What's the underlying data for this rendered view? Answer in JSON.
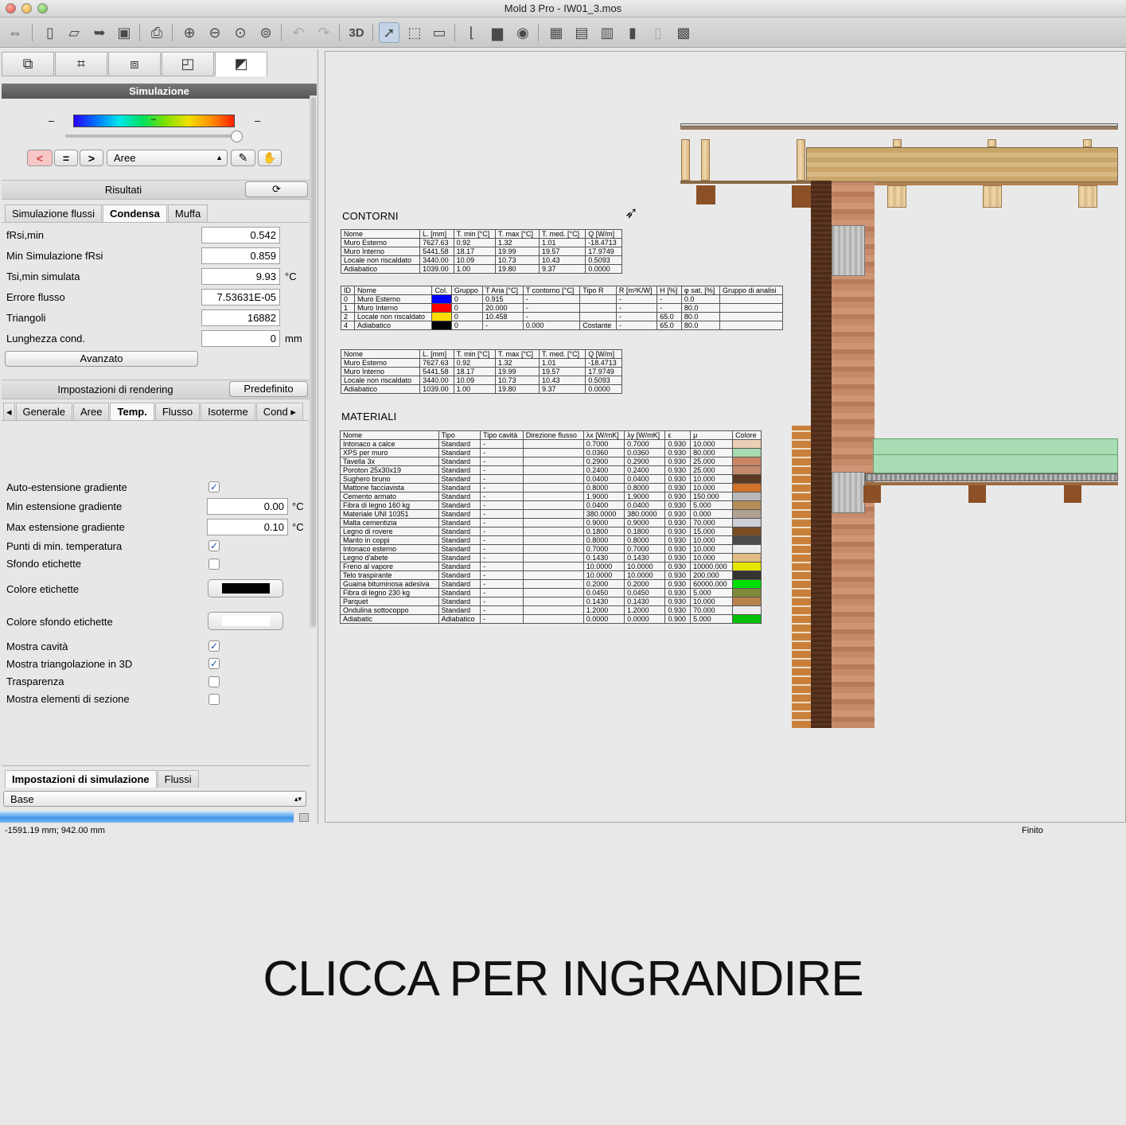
{
  "window": {
    "title": "Mold 3 Pro - IW01_3.mos"
  },
  "toolbar": {
    "label_3d": "3D"
  },
  "sim": {
    "title": "Simulazione",
    "grad_min": "–",
    "grad_mid": "–",
    "grad_max": "–",
    "area_select": "Aree",
    "btn_lt": "<",
    "btn_eq": "=",
    "btn_gt": ">"
  },
  "results": {
    "title": "Risultati",
    "tabs": [
      "Simulazione flussi",
      "Condensa",
      "Muffa"
    ],
    "fields": [
      {
        "label": "fRsi,min",
        "value": "0.542",
        "unit": ""
      },
      {
        "label": "Min Simulazione fRsi",
        "value": "0.859",
        "unit": ""
      },
      {
        "label": "Tsi,min simulata",
        "value": "9.93",
        "unit": "°C"
      },
      {
        "label": "Errore flusso",
        "value": "7.53631E-05",
        "unit": ""
      },
      {
        "label": "Triangoli",
        "value": "16882",
        "unit": ""
      },
      {
        "label": "Lunghezza cond.",
        "value": "0",
        "unit": "mm"
      }
    ],
    "advanced": "Avanzato"
  },
  "render": {
    "title": "Impostazioni di rendering",
    "default_btn": "Predefinito",
    "tabs": [
      "Generale",
      "Aree",
      "Temp.",
      "Flusso",
      "Isoterme",
      "Cond"
    ],
    "auto_ext": "Auto-estensione gradiente",
    "min_ext": "Min estensione gradiente",
    "min_val": "0.00",
    "max_ext": "Max estensione gradiente",
    "max_val": "0.10",
    "unit": "°C",
    "min_pts": "Punti di min. temperatura",
    "label_bg": "Sfondo etichette",
    "label_color": "Colore etichette",
    "label_bg_color": "Colore sfondo etichette",
    "show_cavity": "Mostra cavità",
    "show_tri": "Mostra triangolazione in 3D",
    "transparency": "Trasparenza",
    "show_section": "Mostra elementi di sezione"
  },
  "simsettings": {
    "tabs": [
      "Impostazioni di simulazione",
      "Flussi"
    ],
    "preset": "Base"
  },
  "status": {
    "coords": "-1591.19 mm; 942.00 mm",
    "state": "Finito"
  },
  "canvas": {
    "contorni_title": "CONTORNI",
    "materiali_title": "MATERIALI",
    "flow_header": [
      "Nome",
      "L. [mm]",
      "T. min [°C]",
      "T. max [°C]",
      "T. med. [°C]",
      "Q [W/m]"
    ],
    "flow_rows": [
      [
        "Muro Esterno",
        "7627.63",
        "0.92",
        "1.32",
        "1.01",
        "-18.4713"
      ],
      [
        "Muro Interno",
        "5441.58",
        "18.17",
        "19.99",
        "19.57",
        "17.9749"
      ],
      [
        "Locale non riscaldato",
        "3440.00",
        "10.09",
        "10.73",
        "10.43",
        "0.5093"
      ],
      [
        "Adiabatico",
        "1039.00",
        "1.00",
        "19.80",
        "9.37",
        "0.0000"
      ]
    ],
    "bc_header": [
      "ID",
      "Nome",
      "Col.",
      "Gruppo",
      "T Aria [°C]",
      "T contorno [°C]",
      "Tipo R",
      "R [m²K/W]",
      "H [%]",
      "φ sat. [%]",
      "Gruppo di analisi"
    ],
    "bc_rows": [
      [
        "0",
        "Muro Esterno",
        "#0000ff",
        "0",
        "0.915",
        "-",
        "",
        "-",
        "-",
        "0.0",
        ""
      ],
      [
        "1",
        "Muro Interno",
        "#ff0000",
        "0",
        "20.000",
        "-",
        "",
        "-",
        "-",
        "80.0",
        ""
      ],
      [
        "2",
        "Locale non riscaldato",
        "#ffdd00",
        "0",
        "10.458",
        "-",
        "",
        "-",
        "65.0",
        "80.0",
        ""
      ],
      [
        "4",
        "Adiabatico",
        "#000000",
        "0",
        "-",
        "0.000",
        "Costante",
        "-",
        "65.0",
        "80.0",
        ""
      ]
    ],
    "mat_header": [
      "Nome",
      "Tipo",
      "Tipo cavità",
      "Direzione flusso",
      "λx [W/mK]",
      "λy [W/mK]",
      "ε",
      "μ",
      "Colore"
    ],
    "mat_rows": [
      [
        "Intonaco a calce",
        "Standard",
        "-",
        "",
        "0.7000",
        "0.7000",
        "0.930",
        "10.000",
        "#e8cfb5"
      ],
      [
        "XPS per muro",
        "Standard",
        "-",
        "",
        "0.0360",
        "0.0360",
        "0.930",
        "80.000",
        "#a7dcb0"
      ],
      [
        "Tavella 3x",
        "Standard",
        "-",
        "",
        "0.2900",
        "0.2900",
        "0.930",
        "25.000",
        "#c98464"
      ],
      [
        "Poroton 25x30x19",
        "Standard",
        "-",
        "",
        "0.2400",
        "0.2400",
        "0.930",
        "25.000",
        "#c48a6e"
      ],
      [
        "Sughero bruno",
        "Standard",
        "-",
        "",
        "0.0400",
        "0.0400",
        "0.930",
        "10.000",
        "#5a3a22"
      ],
      [
        "Mattone facciavista",
        "Standard",
        "-",
        "",
        "0.8000",
        "0.8000",
        "0.930",
        "10.000",
        "#d1742a"
      ],
      [
        "Cemento armato",
        "Standard",
        "-",
        "",
        "1.9000",
        "1.9000",
        "0.930",
        "150.000",
        "#b8b8b8"
      ],
      [
        "Fibra di legno 160 kg",
        "Standard",
        "-",
        "",
        "0.0400",
        "0.0400",
        "0.930",
        "5.000",
        "#b58e5a"
      ],
      [
        "Materiale UNI 10351",
        "Standard",
        "-",
        "",
        "380.0000",
        "380.0000",
        "0.930",
        "0.000",
        "#b0a090"
      ],
      [
        "Malta cementizia",
        "Standard",
        "-",
        "",
        "0.9000",
        "0.9000",
        "0.930",
        "70.000",
        "#cfcfd8"
      ],
      [
        "Legno di rovere",
        "Standard",
        "-",
        "",
        "0.1800",
        "0.1800",
        "0.930",
        "15.000",
        "#7a4e22"
      ],
      [
        "Manto in coppi",
        "Standard",
        "-",
        "",
        "0.8000",
        "0.8000",
        "0.930",
        "10.000",
        "#4a4a4a"
      ],
      [
        "Intonaco esterno",
        "Standard",
        "-",
        "",
        "0.7000",
        "0.7000",
        "0.930",
        "10.000",
        "#ececec"
      ],
      [
        "Legno d'abete",
        "Standard",
        "-",
        "",
        "0.1430",
        "0.1430",
        "0.930",
        "10.000",
        "#e0bd86"
      ],
      [
        "Freno al vapore",
        "Standard",
        "-",
        "",
        "10.0000",
        "10.0000",
        "0.930",
        "10000.000",
        "#e6e600"
      ],
      [
        "Telo traspirante",
        "Standard",
        "-",
        "",
        "10.0000",
        "10.0000",
        "0.930",
        "200.000",
        "#333333"
      ],
      [
        "Guaina bituminosa adesiva",
        "Standard",
        "-",
        "",
        "0.2000",
        "0.2000",
        "0.930",
        "60000.000",
        "#00e000"
      ],
      [
        "Fibra di legno 230 kg",
        "Standard",
        "-",
        "",
        "0.0450",
        "0.0450",
        "0.930",
        "5.000",
        "#7e8a3a"
      ],
      [
        "Parquet",
        "Standard",
        "-",
        "",
        "0.1430",
        "0.1430",
        "0.930",
        "10.000",
        "#b8824e"
      ],
      [
        "Ondulina sottocoppo",
        "Standard",
        "-",
        "",
        "1.2000",
        "1.2000",
        "0.930",
        "70.000",
        "#ececec"
      ],
      [
        "Adiabatic",
        "Adiabatico",
        "-",
        "",
        "0.0000",
        "0.0000",
        "0.900",
        "5.000",
        "#00c000"
      ]
    ]
  },
  "banner": "CLICCA PER INGRANDIRE"
}
